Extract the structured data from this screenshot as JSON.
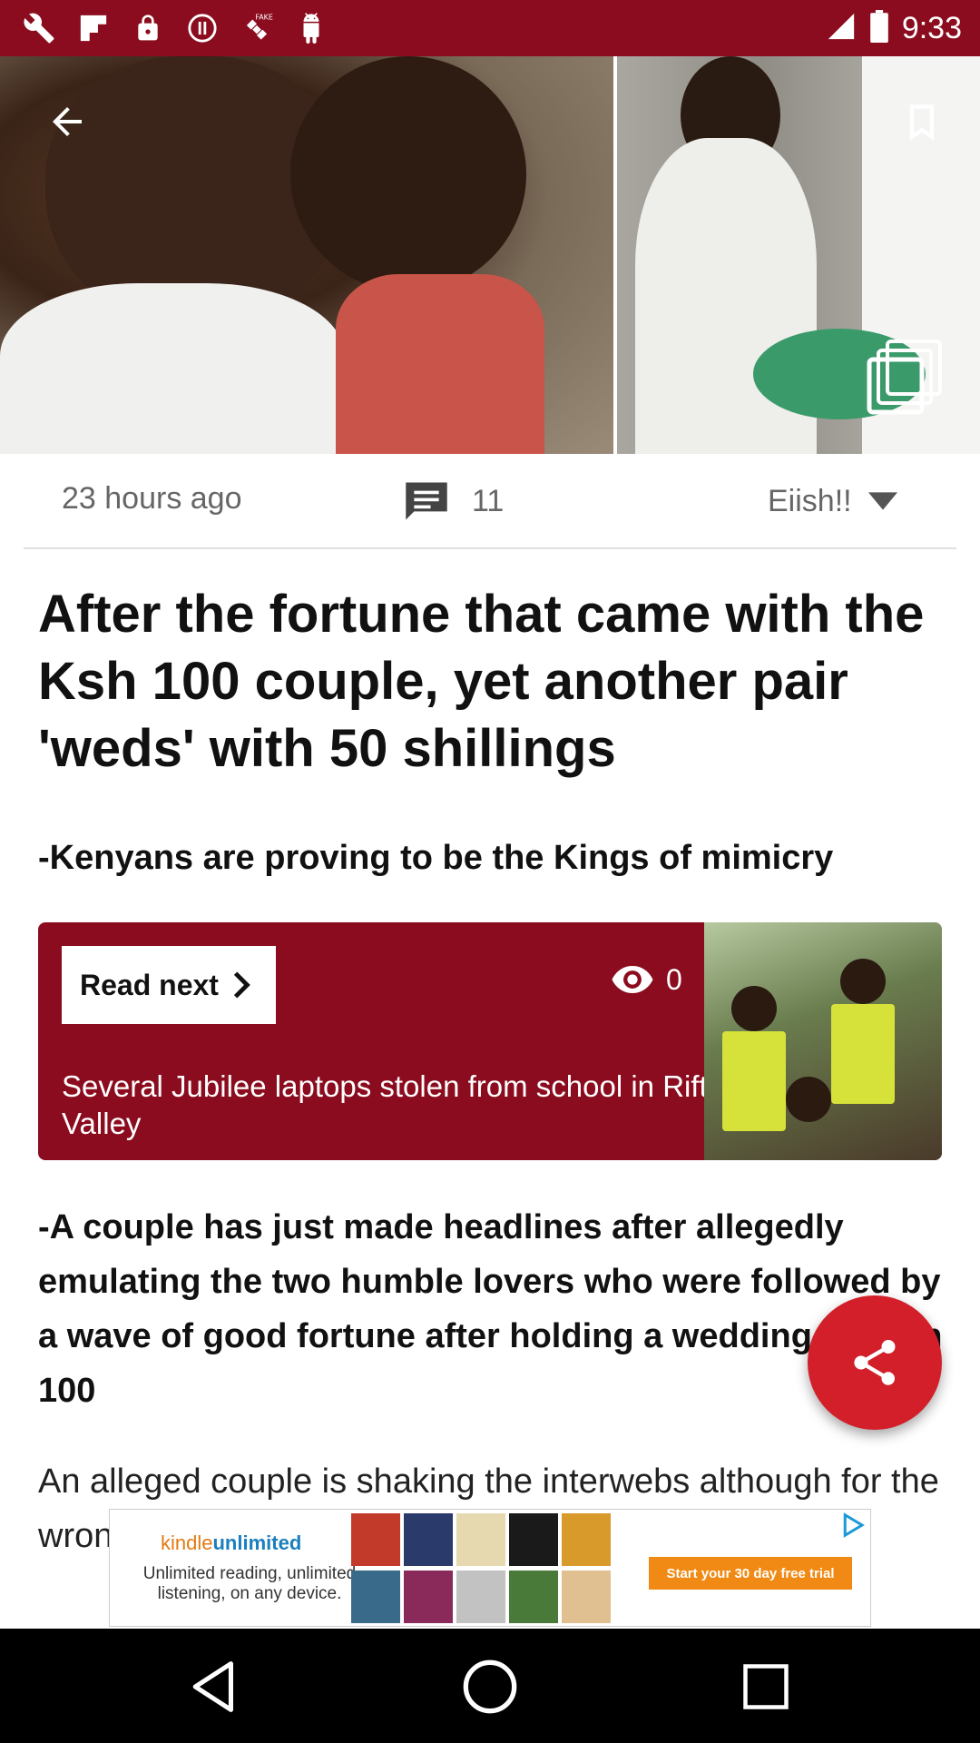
{
  "status_bar": {
    "time": "9:33",
    "background_color": "#8b0c1e",
    "left_icons": [
      "wrench-icon",
      "flipboard-icon",
      "lock-icon",
      "sync-icon",
      "fake-gps-icon",
      "android-debug-icon"
    ]
  },
  "hero": {
    "back_icon": "arrow-back-icon",
    "bookmark_icon": "bookmark-icon",
    "gallery_icon": "gallery-stack-icon"
  },
  "meta": {
    "time_ago": "23 hours ago",
    "comment_count": "11",
    "reaction_label": "Eiish!!"
  },
  "article": {
    "headline": "After the fortune that came with the Ksh 100 couple, yet another pair 'weds' with 50 shillings",
    "subhead": "-Kenyans are proving to be the Kings of mimicry",
    "body_bold": "-A couple has just made headlines after allegedly emulating the two humble lovers who were followed by a wave of good fortune after holding a wedding for Ksh 100",
    "body_text": "An alleged couple is shaking the interwebs although for the wrong reasons, after holding a cheap marriage..."
  },
  "read_next": {
    "button_label": "Read next",
    "views": "0",
    "title": "Several Jubilee laptops stolen from school in Rift Valley",
    "accent_color": "#8b0c1e"
  },
  "ad": {
    "brand_prefix": "kindle",
    "brand_suffix": "unlimited",
    "tagline": "Unlimited reading, unlimited listening, on any device.",
    "cta": "Start your 30 day free trial"
  },
  "fab": {
    "icon": "share-icon",
    "color": "#d21f2a"
  },
  "nav": {
    "back_icon": "nav-back-icon",
    "home_icon": "nav-home-icon",
    "recent_icon": "nav-recent-icon"
  }
}
